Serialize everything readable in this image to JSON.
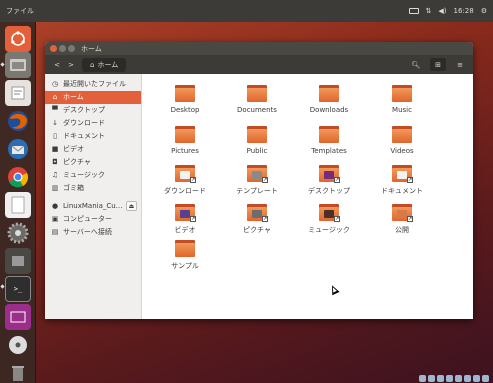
{
  "top_panel": {
    "menu": "ファイル",
    "clock": "16:28"
  },
  "launcher": {
    "items": [
      "ubuntu-dash-icon",
      "files-icon",
      "text-editor-icon",
      "firefox-icon",
      "thunderbird-icon",
      "chrome-icon",
      "document-viewer-icon",
      "settings-icon",
      "media-icon",
      "terminal-icon",
      "screenshot-icon",
      "disc-icon",
      "trash-icon"
    ]
  },
  "window": {
    "title": "ホーム",
    "breadcrumb": "ホーム"
  },
  "sidebar": {
    "items": [
      {
        "label": "最近開いたファイル",
        "icon": "clock-icon"
      },
      {
        "label": "ホーム",
        "icon": "home-icon",
        "active": true
      },
      {
        "label": "デスクトップ",
        "icon": "desktop-icon"
      },
      {
        "label": "ダウンロード",
        "icon": "download-icon"
      },
      {
        "label": "ドキュメント",
        "icon": "document-icon"
      },
      {
        "label": "ビデオ",
        "icon": "video-icon"
      },
      {
        "label": "ピクチャ",
        "icon": "camera-icon"
      },
      {
        "label": "ミュージック",
        "icon": "music-icon"
      },
      {
        "label": "ゴミ箱",
        "icon": "trash-icon"
      },
      {
        "label": "LinuxMania_Cu…",
        "icon": "disc-icon",
        "eject": true
      },
      {
        "label": "コンピューター",
        "icon": "computer-icon"
      },
      {
        "label": "サーバーへ接続",
        "icon": "server-icon"
      }
    ]
  },
  "files": [
    {
      "name": "Desktop"
    },
    {
      "name": "Documents"
    },
    {
      "name": "Downloads"
    },
    {
      "name": "Music"
    },
    {
      "name": "Pictures"
    },
    {
      "name": "Public"
    },
    {
      "name": "Templates"
    },
    {
      "name": "Videos"
    },
    {
      "name": "ダウンロード",
      "emblem": "#f2f2f2"
    },
    {
      "name": "テンプレート",
      "emblem": "#8a8a8a"
    },
    {
      "name": "デスクトップ",
      "emblem": "#7a2a7e"
    },
    {
      "name": "ドキュメント",
      "emblem": "#f2f2f2"
    },
    {
      "name": "ビデオ",
      "emblem": "#5a3f8e"
    },
    {
      "name": "ピクチャ",
      "emblem": "#6d6d6d"
    },
    {
      "name": "ミュージック",
      "emblem": "#4a2f2a"
    },
    {
      "name": "公開",
      "emblem": "#d77a4a"
    },
    {
      "name": "サンプル"
    }
  ]
}
